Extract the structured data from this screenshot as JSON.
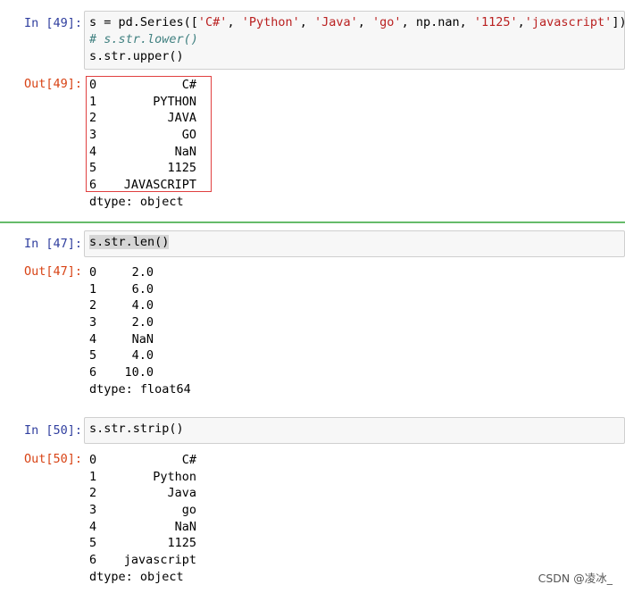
{
  "cells": [
    {
      "in_prompt": "In [49]:",
      "code_lines": [
        [
          {
            "t": "s = pd.Series(["
          },
          {
            "t": "'C#'",
            "c": "str"
          },
          {
            "t": ", "
          },
          {
            "t": "'Python'",
            "c": "str"
          },
          {
            "t": ", "
          },
          {
            "t": "'Java'",
            "c": "str"
          },
          {
            "t": ", "
          },
          {
            "t": "'go'",
            "c": "str"
          },
          {
            "t": ", np.nan, "
          },
          {
            "t": "'1125'",
            "c": "str"
          },
          {
            "t": ","
          },
          {
            "t": "'javascript'",
            "c": "str"
          },
          {
            "t": "])"
          }
        ],
        [
          {
            "t": "# s.str.lower()",
            "c": "cmt"
          }
        ],
        [
          {
            "t": "s.str.upper()"
          }
        ]
      ],
      "out_prompt": "Out[49]:",
      "output_rows": [
        {
          "index": "0",
          "value": "C#"
        },
        {
          "index": "1",
          "value": "PYTHON"
        },
        {
          "index": "2",
          "value": "JAVA"
        },
        {
          "index": "3",
          "value": "GO"
        },
        {
          "index": "4",
          "value": "NaN"
        },
        {
          "index": "5",
          "value": "1125"
        },
        {
          "index": "6",
          "value": "JAVASCRIPT"
        }
      ],
      "dtype": "dtype: object"
    },
    {
      "in_prompt": "In [47]:",
      "code_lines": [
        [
          {
            "t": "s.str.len()",
            "c": "hl"
          }
        ]
      ],
      "out_prompt": "Out[47]:",
      "output_rows": [
        {
          "index": "0",
          "value": "2.0"
        },
        {
          "index": "1",
          "value": "6.0"
        },
        {
          "index": "2",
          "value": "4.0"
        },
        {
          "index": "3",
          "value": "2.0"
        },
        {
          "index": "4",
          "value": "NaN"
        },
        {
          "index": "5",
          "value": "4.0"
        },
        {
          "index": "6",
          "value": "10.0"
        }
      ],
      "dtype": "dtype: float64"
    },
    {
      "in_prompt": "In [50]:",
      "code_lines": [
        [
          {
            "t": "s.str.strip()"
          }
        ]
      ],
      "out_prompt": "Out[50]:",
      "output_rows": [
        {
          "index": "0",
          "value": "C#"
        },
        {
          "index": "1",
          "value": "Python"
        },
        {
          "index": "2",
          "value": "Java"
        },
        {
          "index": "3",
          "value": "go"
        },
        {
          "index": "4",
          "value": "NaN"
        },
        {
          "index": "5",
          "value": "1125"
        },
        {
          "index": "6",
          "value": "javascript"
        }
      ],
      "dtype": "dtype: object"
    }
  ],
  "watermark": "CSDN @凌冰_",
  "colors": {
    "in_prompt": "#303f9f",
    "out_prompt": "#d84315",
    "string": "#ba2121",
    "comment": "#408080",
    "highlight_box": "#e04040",
    "selected_cell_bar": "#66bb6a"
  }
}
